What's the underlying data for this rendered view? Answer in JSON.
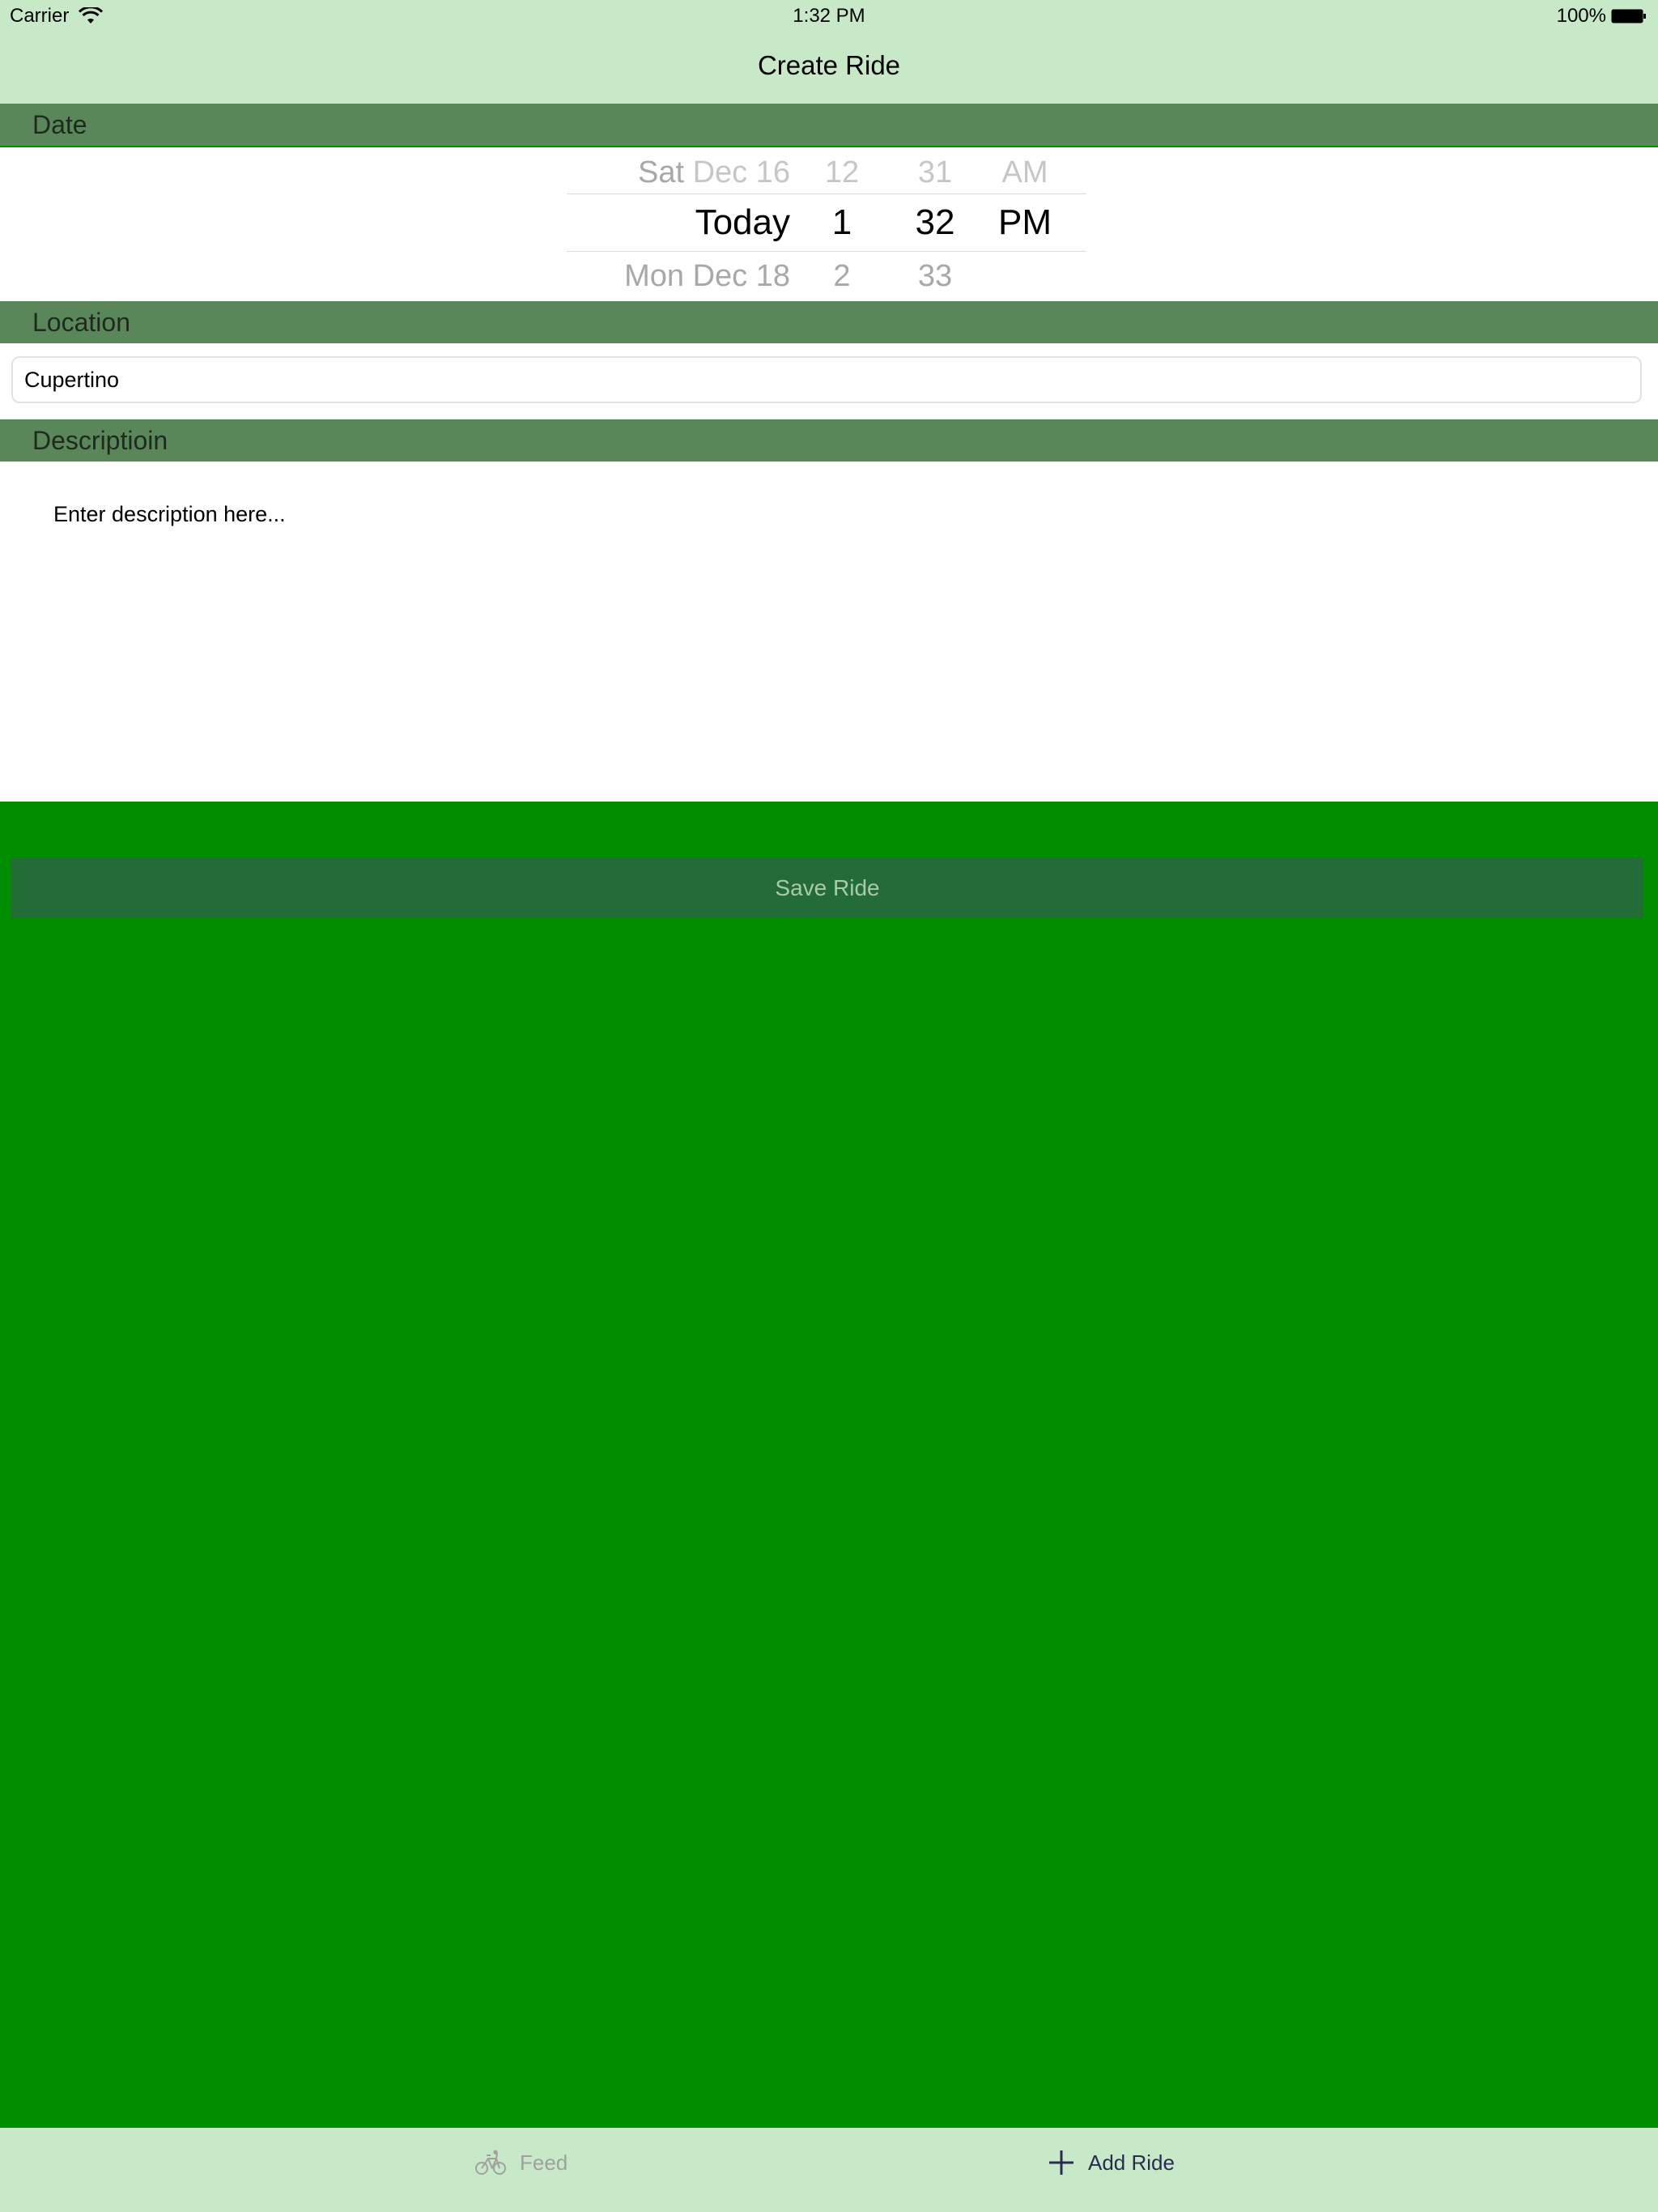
{
  "status_bar": {
    "carrier": "Carrier",
    "time": "1:32 PM",
    "battery": "100%"
  },
  "nav": {
    "title": "Create Ride"
  },
  "date_section": {
    "header": "Date",
    "picker": {
      "prev": {
        "day_prefix": "Sat",
        "day_rest": "Dec 16",
        "hour": "12",
        "minute": "31",
        "ampm": "AM"
      },
      "curr": {
        "day": "Today",
        "hour": "1",
        "minute": "32",
        "ampm": "PM"
      },
      "next": {
        "day": "Mon Dec 18",
        "hour": "2",
        "minute": "33"
      }
    }
  },
  "location_section": {
    "header": "Location",
    "value": "Cupertino"
  },
  "description_section": {
    "header": "Descriptioin",
    "text": "Enter description here..."
  },
  "save_button": {
    "label": "Save Ride"
  },
  "tab_bar": {
    "tabs": [
      {
        "label": "Feed",
        "icon": "bicycle-icon"
      },
      {
        "label": "Add Ride",
        "icon": "plus-icon"
      }
    ]
  },
  "colors": {
    "bar_background": "#c8e9c8",
    "section_header": "#5a875a",
    "main_background": "#008e00",
    "save_button": "#246c37"
  }
}
